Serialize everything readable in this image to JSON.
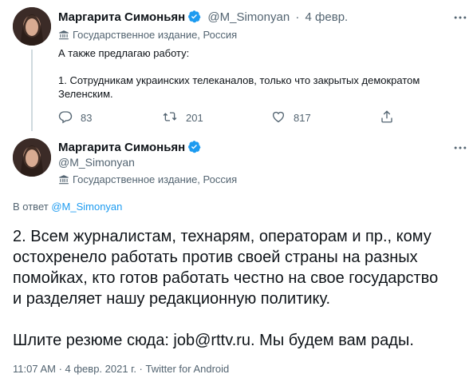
{
  "colors": {
    "accent": "#1d9bf0",
    "text": "#0f1419",
    "secondary": "#536471",
    "thread_line": "#cfd9de"
  },
  "tweet1": {
    "author_name": "Маргарита Симоньян",
    "handle": "@M_Simonyan",
    "separator": "·",
    "date": "4 февр.",
    "label": "Государственное издание, Россия",
    "text_line1": "А также предлагаю работу:",
    "text_line2": "1. Сотрудникам украинских телеканалов, только что закрытых демократом",
    "text_line3": "Зеленским.",
    "replies": "83",
    "retweets": "201",
    "likes": "817"
  },
  "tweet2": {
    "author_name": "Маргарита Симоньян",
    "handle": "@M_Simonyan",
    "label": "Государственное издание, Россия",
    "reply_prefix": "В ответ",
    "reply_to": "@M_Simonyan",
    "body_lines": [
      "2. Всем журналистам, технарям, операторам и пр., кому",
      "остохренело работать против своей страны на разных",
      "помойках, кто готов работать честно на свое государство",
      "и разделяет нашу редакционную политику."
    ],
    "cv_line": "Шлите резюме сюда: job@rttv.ru. Мы будем вам рады.",
    "meta": "11:07 AM · 4 февр. 2021 г. · Twitter for Android"
  },
  "icons": {
    "verified": "verified-badge-icon",
    "more": "more-dots-icon",
    "gov": "state-media-icon",
    "reply": "reply-icon",
    "retweet": "retweet-icon",
    "like": "like-icon",
    "share": "share-icon"
  }
}
